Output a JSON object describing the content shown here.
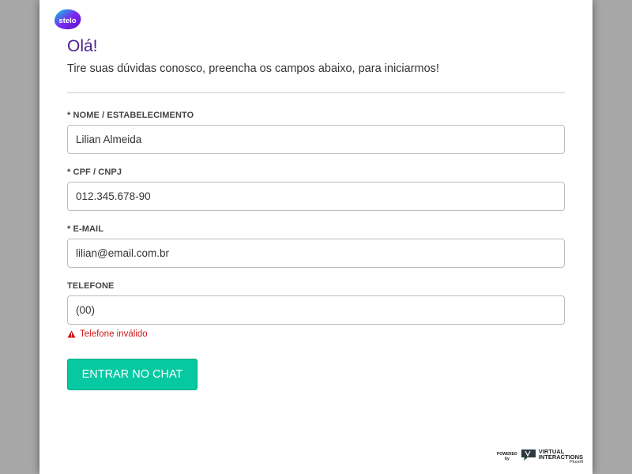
{
  "brand": {
    "logo_text": "stelo"
  },
  "header": {
    "greeting": "Olá!",
    "subtitle": "Tire suas dúvidas conosco, preencha os campos abaixo, para iniciarmos!"
  },
  "form": {
    "fields": [
      {
        "label": "* NOME / ESTABELECIMENTO",
        "value": "Lilian Almeida"
      },
      {
        "label": "* CPF / CNPJ",
        "value": "012.345.678-90"
      },
      {
        "label": "* E-MAIL",
        "value": "lilian@email.com.br"
      },
      {
        "label": "TELEFONE",
        "value": "(00)"
      }
    ],
    "phone_error": "Telefone inválido",
    "submit_label": "ENTRAR NO CHAT"
  },
  "footer": {
    "powered_line1": "POWERED",
    "powered_line2": "by",
    "brand_line1": "VIRTUAL",
    "brand_line2": "INTERACTIONS",
    "brand_line3": "Plusoft"
  },
  "colors": {
    "accent": "#06c9a2",
    "heading": "#4b1b8f",
    "error": "#cc1a1a",
    "backdrop": "#a7a7a7"
  },
  "icons": [
    "stelo-logo-icon",
    "warning-icon",
    "virtual-interactions-logo-icon"
  ]
}
